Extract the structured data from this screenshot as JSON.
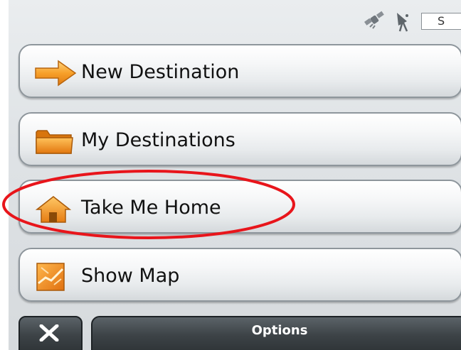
{
  "status_bar": {
    "icons": [
      "satellite-icon",
      "gps-antenna-icon"
    ],
    "box_label": "S"
  },
  "menu": {
    "items": [
      {
        "label": "New Destination",
        "icon": "arrow-right-icon"
      },
      {
        "label": "My Destinations",
        "icon": "folder-icon"
      },
      {
        "label": "Take Me Home",
        "icon": "house-icon"
      },
      {
        "label": "Show Map",
        "icon": "map-icon"
      }
    ]
  },
  "bottom_bar": {
    "close_icon": "close-icon",
    "options_label": "Options"
  },
  "annotation": {
    "highlighted_item": "Take Me Home",
    "color": "#e8151b"
  },
  "colors": {
    "icon_orange": "#f39420",
    "dark_bar": "#3d4347"
  }
}
